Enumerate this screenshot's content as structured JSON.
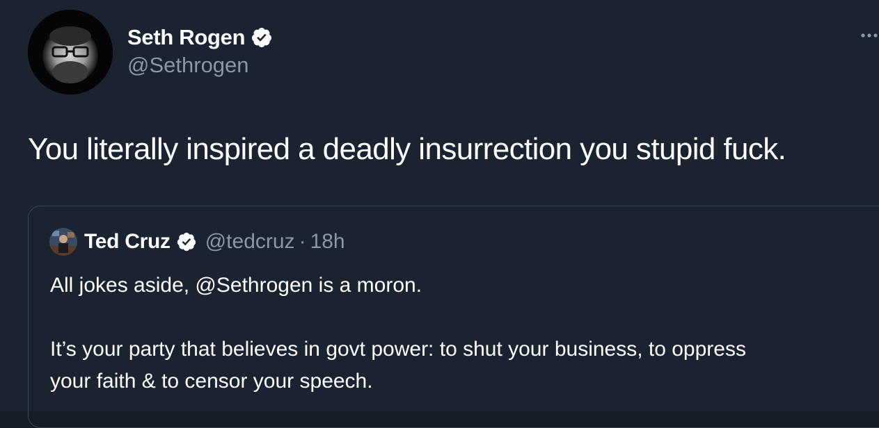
{
  "tweet": {
    "author": {
      "display_name": "Seth Rogen",
      "handle": "@Sethrogen",
      "verified_icon": "verified-badge-icon"
    },
    "more_icon": "more-options-icon",
    "text": "You literally inspired a deadly insurrection you stupid fuck."
  },
  "quoted_tweet": {
    "author": {
      "display_name": "Ted Cruz",
      "handle": "@tedcruz",
      "verified_icon": "verified-badge-icon"
    },
    "separator": "·",
    "time": "18h",
    "lines": [
      "All jokes aside, @Sethrogen is a moron.",
      "It’s your party that believes in govt power: to shut your business, to oppress",
      "your faith & to censor your speech."
    ]
  },
  "colors": {
    "background": "#1b2230",
    "text_primary": "#ffffff",
    "text_secondary": "#8b97a5",
    "card_border": "#3c4655"
  }
}
